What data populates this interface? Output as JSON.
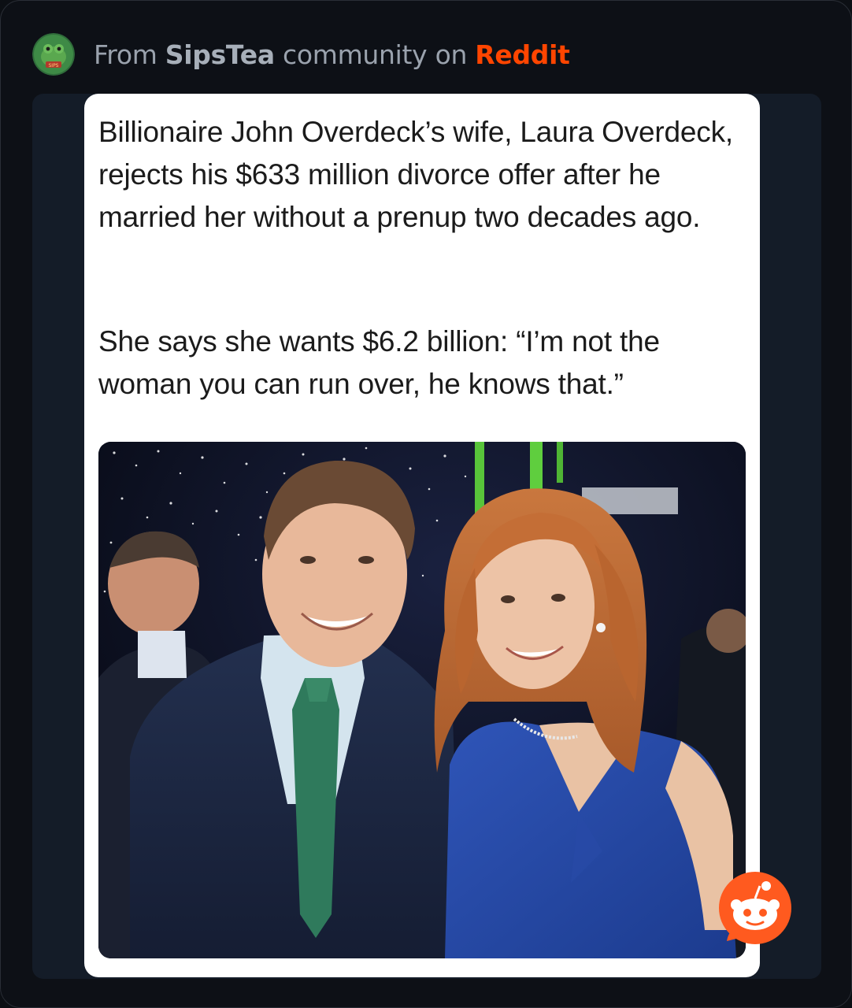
{
  "header": {
    "prefix": "From",
    "community": "SipsTea",
    "middle": "community on",
    "platform": "Reddit",
    "avatar_icon": "frog-avatar-icon",
    "platform_color": "#ff4500"
  },
  "post": {
    "headline": "Billionaire John Overdeck’s wife, Laura Overdeck, rejects his $633 million divorce offer after he married her without a prenup two decades ago.",
    "quote": "She says she wants $6.2 billion: “I’m not the woman you can run over, he knows that.”",
    "photo_icon": "couple-photo"
  },
  "watermark": {
    "icon": "reddit-snoo-icon"
  }
}
